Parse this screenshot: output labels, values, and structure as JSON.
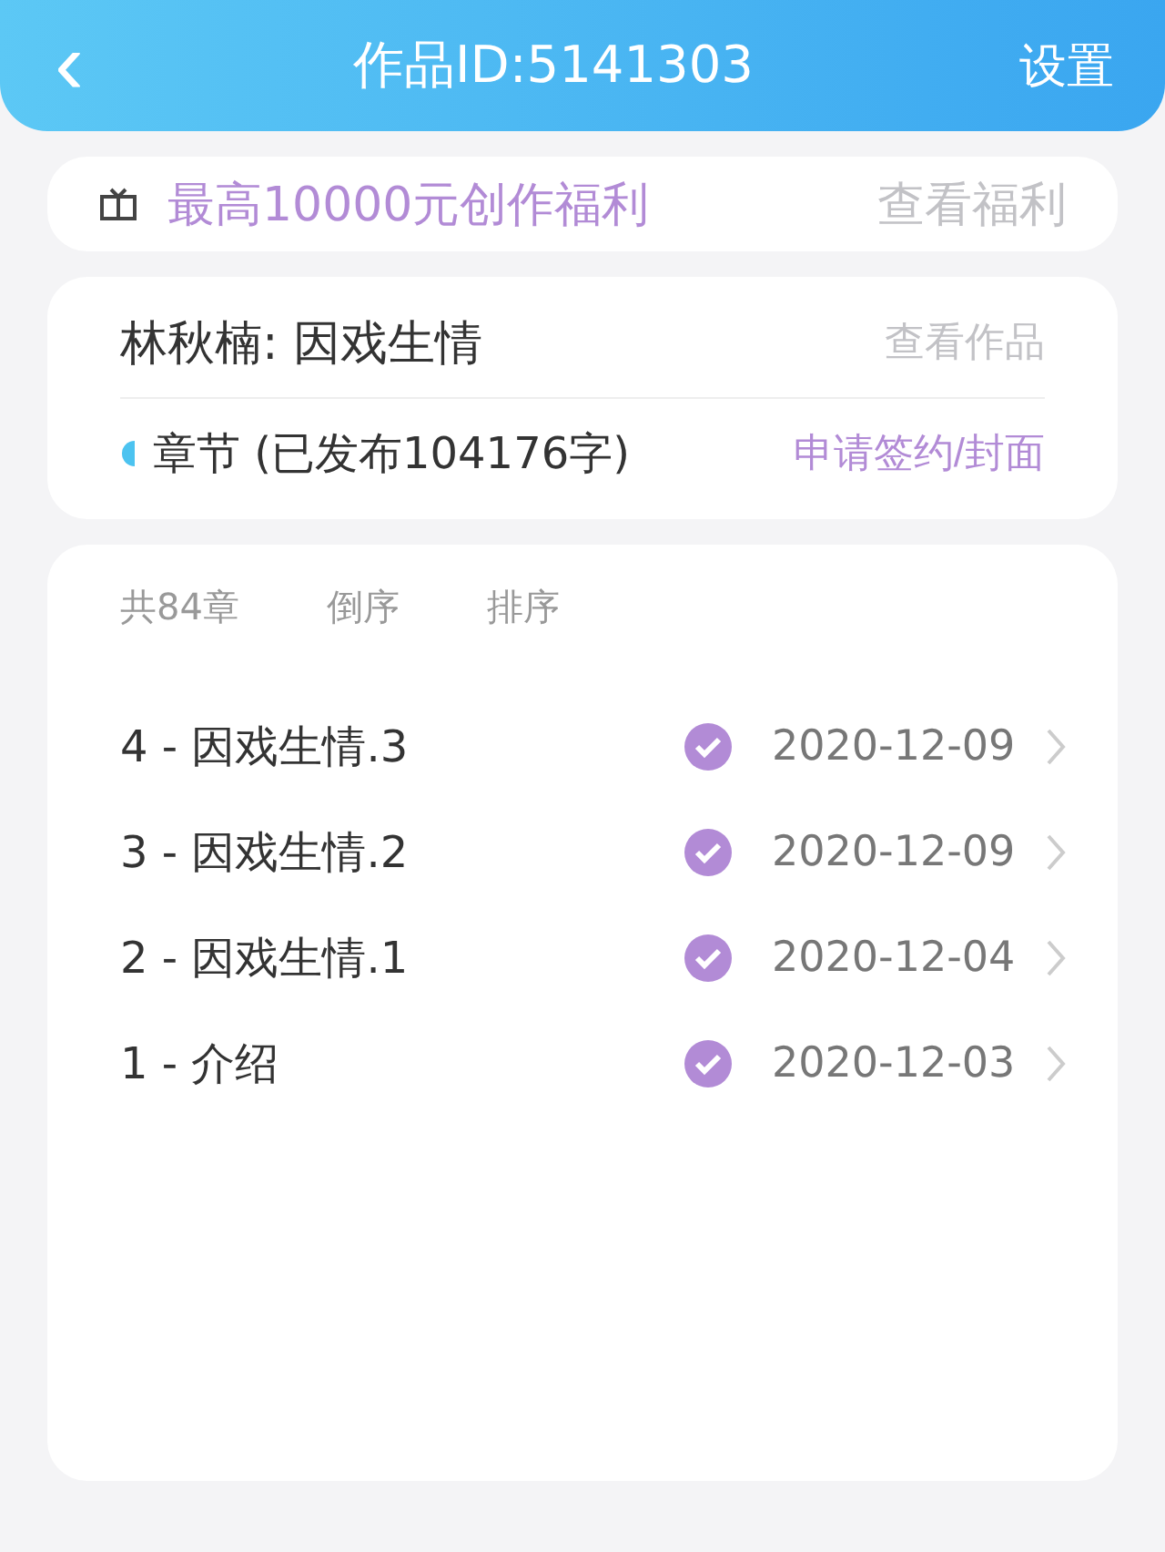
{
  "header": {
    "back": "‹",
    "title": "作品ID:5141303",
    "settings": "设置"
  },
  "welfare": {
    "text": "最高10000元创作福利",
    "link": "查看福利"
  },
  "work": {
    "title": "林秋楠: 因戏生情",
    "view": "查看作品",
    "chapters_label": "章节 (已发布104176字)",
    "sign": "申请签约/封面"
  },
  "list": {
    "count": "共84章",
    "reverse": "倒序",
    "sort": "排序",
    "chapters": [
      {
        "title": "4 - 因戏生情.3",
        "published": true,
        "date": "2020-12-09"
      },
      {
        "title": "3 - 因戏生情.2",
        "published": true,
        "date": "2020-12-09"
      },
      {
        "title": "2 - 因戏生情.1",
        "published": true,
        "date": "2020-12-04"
      },
      {
        "title": "1 - 介绍",
        "published": true,
        "date": "2020-12-03"
      }
    ]
  }
}
